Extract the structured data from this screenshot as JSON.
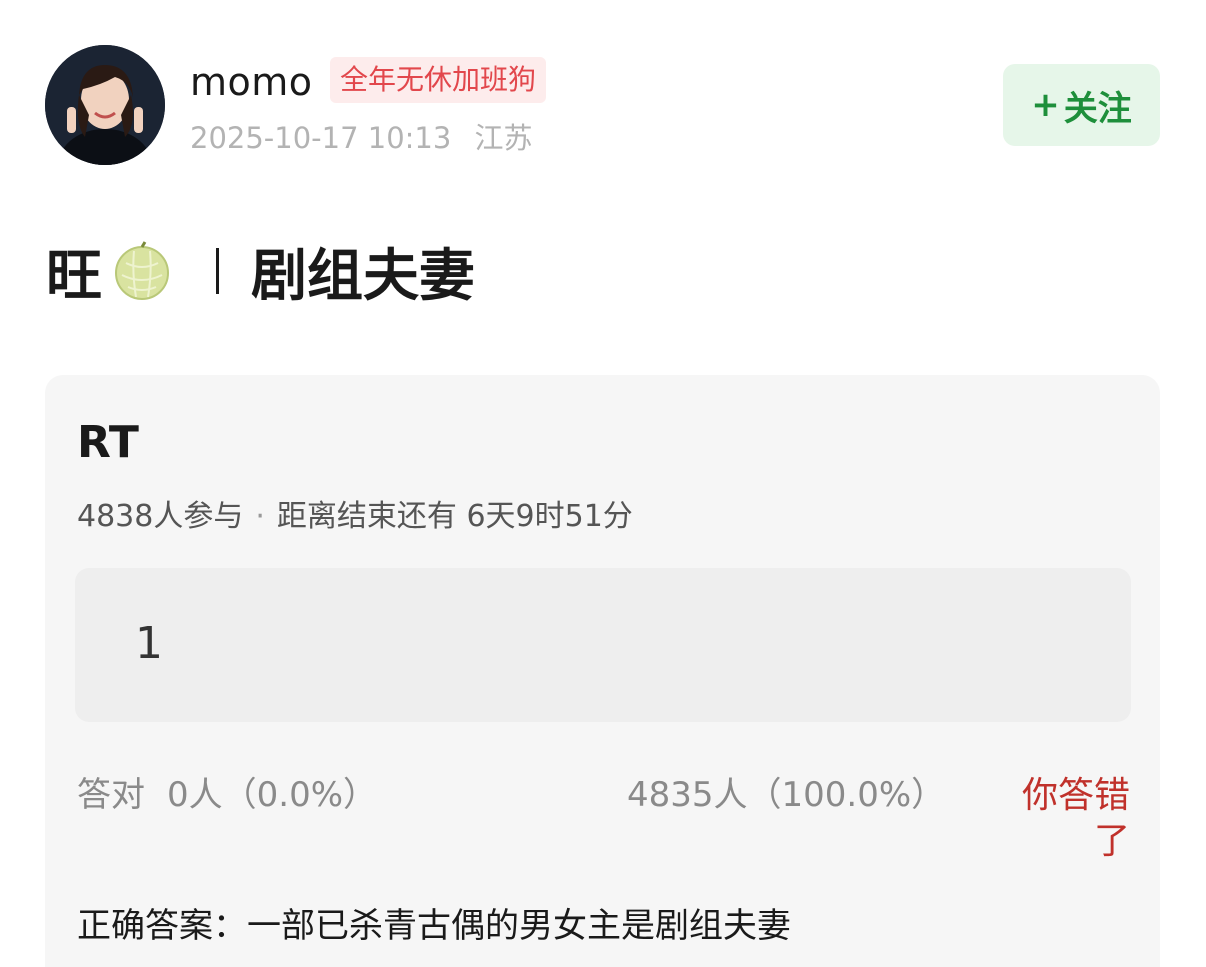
{
  "user": {
    "name": "momo",
    "badge": "全年无休加班狗",
    "timestamp": "2025-10-17 10:13",
    "location": "江苏"
  },
  "follow_button": {
    "plus": "+",
    "label": "关注"
  },
  "post": {
    "title_prefix": "旺",
    "title_icon": "melon-icon",
    "title_main": "剧组夫妻"
  },
  "quiz": {
    "question": "RT",
    "participants": "4838人参与",
    "separator": "·",
    "time_left": "距离结束还有 6天9时51分",
    "option_label": "1",
    "correct_label": "答对",
    "correct_stat": "0人（0.0%）",
    "wrong_stat": "4835人（100.0%）",
    "verdict": "你答错了",
    "answer_text": "正确答案：一部已杀青古偶的男女主是剧组夫妻"
  },
  "colors": {
    "badge_text": "#e2474c",
    "follow_green": "#1e8f3b",
    "verdict_red": "#c0312b"
  }
}
